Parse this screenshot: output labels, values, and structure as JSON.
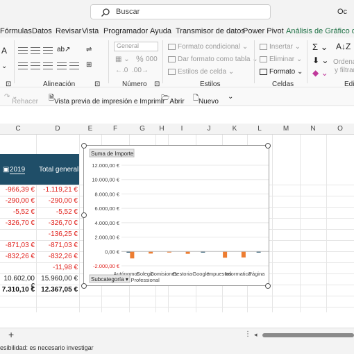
{
  "search": {
    "placeholder": "Buscar"
  },
  "title_user": "Oc",
  "menu": [
    "Fórmulas",
    "Datos",
    "Revisar",
    "Vista",
    "Programador",
    "Ayuda",
    "Transmisor de datos",
    "Power Pivot",
    "Análisis de Gráfico diná"
  ],
  "ribbon": {
    "groups": {
      "alineacion": "Alineación",
      "numero": "Número",
      "estilos": "Estilos",
      "celdas": "Celdas",
      "edicion": "Edi"
    },
    "number_format": "General",
    "styles": {
      "conditional": "Formato condicional",
      "as_table": "Dar formato como tabla",
      "cell_styles": "Estilos de celda"
    },
    "cells": {
      "insert": "Insertar",
      "delete": "Eliminar",
      "format": "Formato"
    },
    "editing": {
      "order_1": "Ordenar",
      "order_2": "y filtrar"
    },
    "percent": "%",
    "thousands": "000"
  },
  "qat": {
    "redo": "Rehacer",
    "print_preview": "Vista previa de impresión e Imprimir",
    "open": "Abrir",
    "new": "Nuevo"
  },
  "columns": [
    "C",
    "D",
    "E",
    "F",
    "G",
    "H",
    "I",
    "J",
    "K",
    "L",
    "M",
    "N",
    "O"
  ],
  "pivot": {
    "header_year": "2019",
    "header_total": "Total general",
    "rows": [
      {
        "c": "-966,39 €",
        "d": "-1.119,21 €",
        "red": true
      },
      {
        "c": "-290,00 €",
        "d": "-290,00 €",
        "red": true
      },
      {
        "c": "-5,52 €",
        "d": "-5,52 €",
        "red": true
      },
      {
        "c": "-326,70 €",
        "d": "-326,70 €",
        "red": true
      },
      {
        "c": "",
        "d": "-136,25 €",
        "red": true
      },
      {
        "c": "-871,03 €",
        "d": "-871,03 €",
        "red": true
      },
      {
        "c": "-832,26 €",
        "d": "-832,26 €",
        "red": true
      },
      {
        "c": "",
        "d": "-11,98 €",
        "red": true
      },
      {
        "c": "10.602,00 €",
        "d": "15.960,00 €",
        "red": false
      },
      {
        "c": "7.310,10 €",
        "d": "12.367,05 €",
        "red": false,
        "bold": true
      }
    ]
  },
  "chart_data": {
    "type": "bar",
    "value_field_button": "Suma de Importe",
    "axis_field_button": "Subcategoría",
    "categories": [
      "Autónomos",
      "Colegio Professional",
      "Comisiones",
      "Gestoria",
      "Google",
      "Impuestos",
      "Informatica",
      "Página"
    ],
    "y_ticks": [
      "12.000,00 €",
      "10.000,00 €",
      "8.000,00 €",
      "6.000,00 €",
      "4.000,00 €",
      "2.000,00 €",
      "0,00 €",
      "-2.000,00 €"
    ],
    "ylim": [
      -2000,
      12000
    ],
    "series": [
      {
        "values": [
          -152.82,
          0,
          0,
          0,
          -136.25,
          0,
          0,
          -11.98
        ],
        "color": "#1f4e68"
      },
      {
        "values": [
          -966.39,
          -290,
          -5.52,
          -326.7,
          0,
          -871.03,
          -832.26,
          0
        ],
        "color": "#ed7d31"
      }
    ]
  },
  "status": {
    "accessibility": "esibilidad: es necesario investigar"
  }
}
